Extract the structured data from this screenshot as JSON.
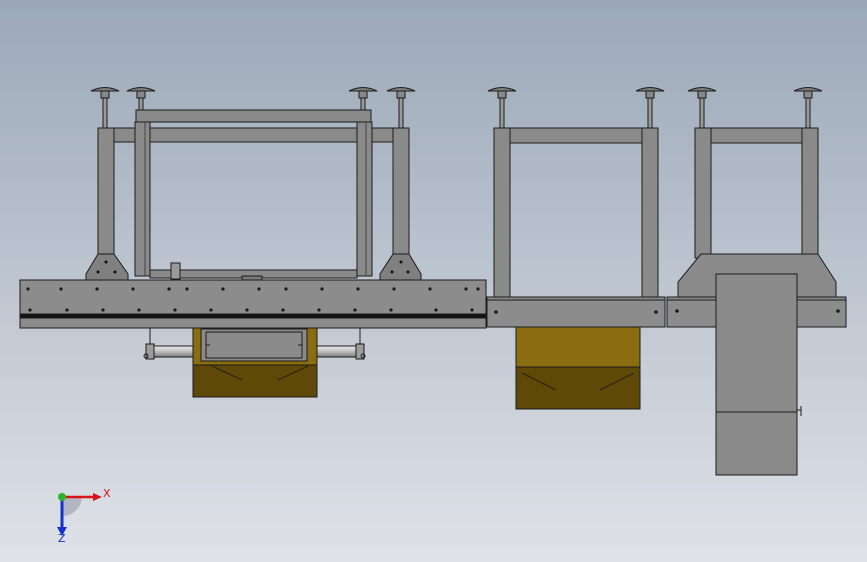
{
  "colors": {
    "background_top": "#9eaaba",
    "background_bottom": "#dadde4",
    "frame_steel": "#8a8a8a",
    "frame_steel_dark": "#6f6f6f",
    "outline": "#1c1c1c",
    "hopper_light": "#8a6d10",
    "hopper_dark": "#5a4608",
    "roller": "#c9c9c9",
    "axis_x": "#d8141b",
    "axis_y": "#2ab52a",
    "axis_z": "#1a2fd0"
  },
  "triad": {
    "x_label": "X",
    "z_label": "Z"
  },
  "components": [
    "leveling-foot",
    "main-frame",
    "middle-frame",
    "right-frame",
    "conveyor-beam",
    "hopper",
    "roller",
    "motor-housing"
  ]
}
